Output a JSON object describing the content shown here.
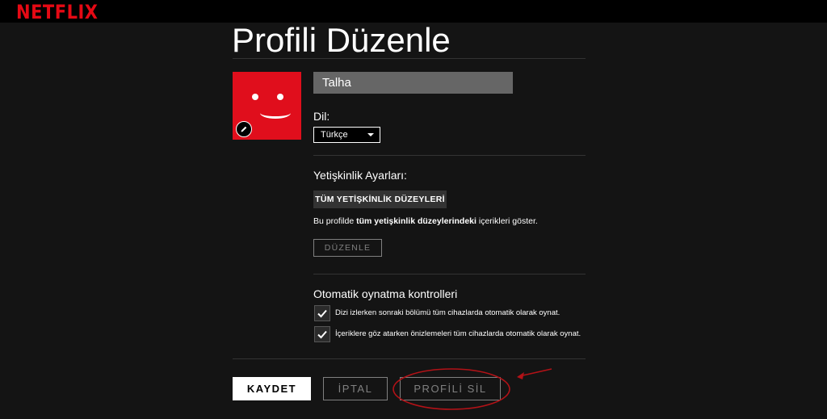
{
  "brand": {
    "logo_text": "NETFLIX",
    "color": "#e50914"
  },
  "page": {
    "title": "Profili Düzenle"
  },
  "profile": {
    "name": "Talha",
    "avatar_color": "#e00e1c",
    "avatar_icon": "smiley-face-icon",
    "edit_icon": "pencil-icon"
  },
  "language": {
    "label": "Dil:",
    "selected": "Türkçe"
  },
  "maturity": {
    "heading": "Yetişkinlik Ayarları:",
    "badge": "TÜM YETİŞKİNLİK DÜZEYLERİ",
    "description_prefix": "Bu profilde ",
    "description_bold": "tüm yetişkinlik düzeylerindeki",
    "description_suffix": " içerikleri göster.",
    "edit_button": "DÜZENLE"
  },
  "autoplay": {
    "heading": "Otomatik oynatma kontrolleri",
    "options": [
      {
        "label": "Dizi izlerken sonraki bölümü tüm cihazlarda otomatik olarak oynat.",
        "checked": true
      },
      {
        "label": "İçeriklere göz atarken önizlemeleri tüm cihazlarda otomatik olarak oynat.",
        "checked": true
      }
    ]
  },
  "actions": {
    "save": "KAYDET",
    "cancel": "İPTAL",
    "delete": "PROFİLİ SİL"
  },
  "annotation": {
    "color": "#b31217"
  }
}
